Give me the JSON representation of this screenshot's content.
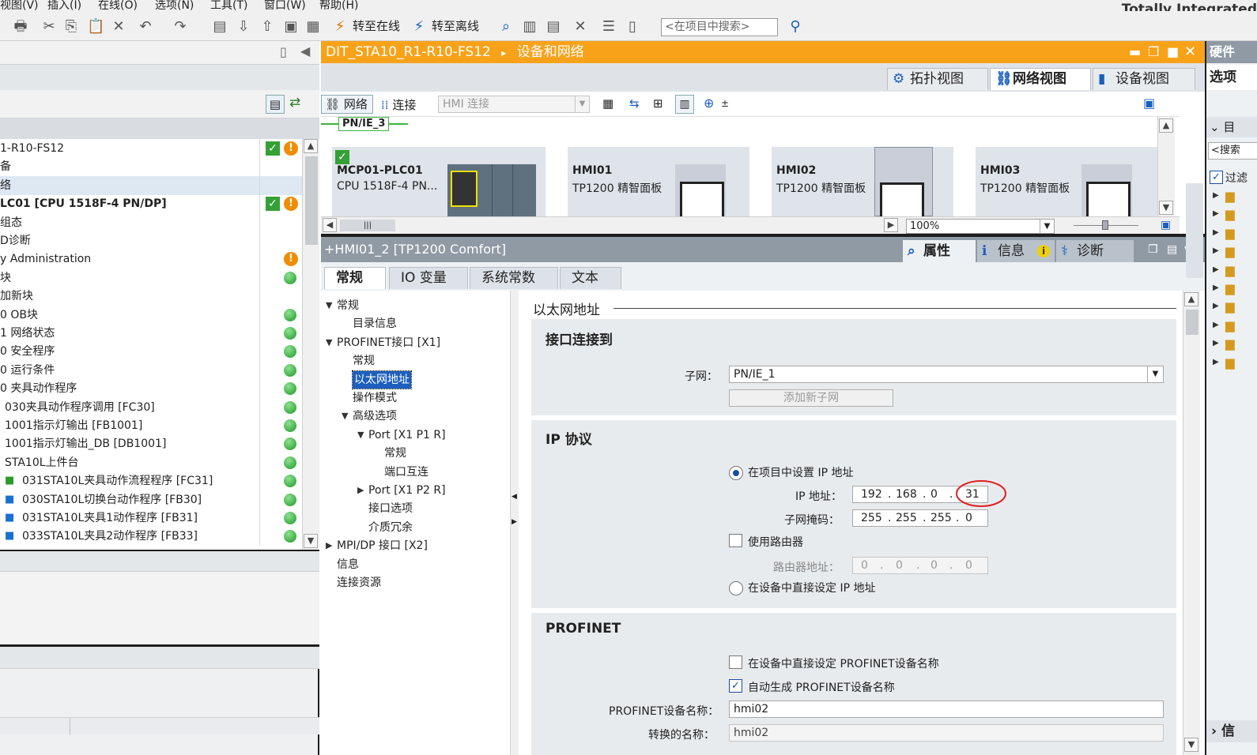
{
  "menu": [
    "视图(V)",
    "插入(I)",
    "在线(O)",
    "选项(N)",
    "工具(T)",
    "窗口(W)",
    "帮助(H)"
  ],
  "brand": "Totally Integrated",
  "toolbar": {
    "go_online": "转至在线",
    "go_offline": "转至离线",
    "search_placeholder": "<在项目中搜索>"
  },
  "left_tree": [
    {
      "label": "1-R10-FS12",
      "indent": 0,
      "status": [
        "ok",
        "warn"
      ]
    },
    {
      "label": "备",
      "indent": 0,
      "status": []
    },
    {
      "label": "络",
      "indent": 0,
      "status": [],
      "selected": true
    },
    {
      "label": "LC01 [CPU 1518F-4 PN/DP]",
      "indent": 0,
      "bold": true,
      "status": [
        "ok",
        "warn"
      ]
    },
    {
      "label": "组态",
      "indent": 0,
      "status": []
    },
    {
      "label": "D诊断",
      "indent": 0,
      "status": []
    },
    {
      "label": "y Administration",
      "indent": 0,
      "status": [
        "warn"
      ]
    },
    {
      "label": "块",
      "indent": 0,
      "status": [
        "green"
      ]
    },
    {
      "label": "加新块",
      "indent": 0,
      "status": []
    },
    {
      "label": "0 OB块",
      "indent": 0,
      "status": [
        "green"
      ]
    },
    {
      "label": "1 网络状态",
      "indent": 0,
      "status": [
        "green"
      ]
    },
    {
      "label": "0 安全程序",
      "indent": 0,
      "status": [
        "green"
      ]
    },
    {
      "label": "0 运行条件",
      "indent": 0,
      "status": [
        "green"
      ]
    },
    {
      "label": "0 夹具动作程序",
      "indent": 0,
      "status": [
        "green"
      ]
    },
    {
      "label": "030夹具动作程序调用 [FC30]",
      "indent": 6,
      "status": [
        "green"
      ]
    },
    {
      "label": "1001指示灯输出 [FB1001]",
      "indent": 6,
      "status": [
        "green"
      ]
    },
    {
      "label": "1001指示灯输出_DB [DB1001]",
      "indent": 6,
      "status": [
        "green"
      ]
    },
    {
      "label": "STA10L上件台",
      "indent": 6,
      "status": [
        "green"
      ]
    },
    {
      "label": "031STA10L夹具动作流程程序 [FC31]",
      "indent": 28,
      "icon": "fc",
      "status": [
        "green"
      ]
    },
    {
      "label": "030STA10L切换台动作程序 [FB30]",
      "indent": 28,
      "icon": "fb",
      "status": [
        "green"
      ]
    },
    {
      "label": "031STA10L夹具1动作程序 [FB31]",
      "indent": 28,
      "icon": "fb",
      "status": [
        "green"
      ]
    },
    {
      "label": "033STA10L夹具2动作程序 [FB33]",
      "indent": 28,
      "icon": "fb",
      "status": [
        "green"
      ]
    }
  ],
  "editor": {
    "breadcrumb_project": "DIT_STA10_R1-R10-FS12",
    "breadcrumb_sep": "▸",
    "breadcrumb_page": "设备和网络",
    "view_tabs": [
      "拓扑视图",
      "网络视图",
      "设备视图"
    ],
    "net_tool_network": "网络",
    "net_tool_connection": "连接",
    "hmi_connection": "HMI 连接",
    "subnet_tag": "PN/IE_3",
    "zoom": "100%",
    "devices": [
      {
        "name": "MCP01-PLC01",
        "type": "CPU 1518F-4 PN..."
      },
      {
        "name": "HMI01",
        "type": "TP1200 精智面板"
      },
      {
        "name": "HMI02",
        "type": "TP1200 精智面板"
      },
      {
        "name": "HMI03",
        "type": "TP1200 精智面板"
      }
    ]
  },
  "inspector": {
    "title": "+HMI01_2 [TP1200 Comfort]",
    "tabs": [
      "属性",
      "信息",
      "诊断"
    ],
    "subtabs": [
      "常规",
      "IO 变量",
      "系统常数",
      "文本"
    ],
    "nav": [
      {
        "label": "常规",
        "level": 0,
        "arrow": "down"
      },
      {
        "label": "目录信息",
        "level": 1
      },
      {
        "label": "PROFINET接口 [X1]",
        "level": 0,
        "arrow": "down"
      },
      {
        "label": "常规",
        "level": 1
      },
      {
        "label": "以太网地址",
        "level": 1,
        "selected": true
      },
      {
        "label": "操作模式",
        "level": 1
      },
      {
        "label": "高级选项",
        "level": 1,
        "arrow": "down"
      },
      {
        "label": "Port [X1 P1 R]",
        "level": 2,
        "arrow": "down"
      },
      {
        "label": "常规",
        "level": 3
      },
      {
        "label": "端口互连",
        "level": 3
      },
      {
        "label": "Port [X1 P2 R]",
        "level": 2,
        "arrow": "right"
      },
      {
        "label": "接口选项",
        "level": 2
      },
      {
        "label": "介质冗余",
        "level": 2
      },
      {
        "label": "MPI/DP 接口 [X2]",
        "level": 0,
        "arrow": "right"
      },
      {
        "label": "信息",
        "level": 0
      },
      {
        "label": "连接资源",
        "level": 0
      }
    ],
    "ethernet": {
      "heading": "以太网地址",
      "connected_heading": "接口连接到",
      "subnet_label": "子网：",
      "subnet_value": "PN/IE_1",
      "add_subnet": "添加新子网",
      "ip_heading": "IP 协议",
      "radio_in_project": "在项目中设置 IP 地址",
      "ip_label": "IP 地址：",
      "ip": [
        "192",
        "168",
        "0",
        "31"
      ],
      "mask_label": "子网掩码：",
      "mask": [
        "255",
        "255",
        "255",
        "0"
      ],
      "use_router": "使用路由器",
      "router_label": "路由器地址：",
      "router": [
        "0",
        "0",
        "0",
        "0"
      ],
      "radio_on_device": "在设备中直接设定 IP 地址",
      "profinet_heading": "PROFINET",
      "pn_direct": "在设备中直接设定 PROFINET设备名称",
      "pn_auto": "自动生成 PROFINET设备名称",
      "pn_name_label": "PROFINET设备名称：",
      "pn_name": "hmi02",
      "conv_name_label": "转换的名称：",
      "conv_name": "hmi02"
    }
  },
  "right_panel": {
    "title": "硬件",
    "options": "选项",
    "catalog": "目",
    "search": "<搜索",
    "filter": "过滤",
    "bottom": "信"
  },
  "colors": {
    "accent": "#f8a21a",
    "highlight_circle": "#e02020",
    "status_ok": "#35a035",
    "status_warn": "#f08c00"
  }
}
